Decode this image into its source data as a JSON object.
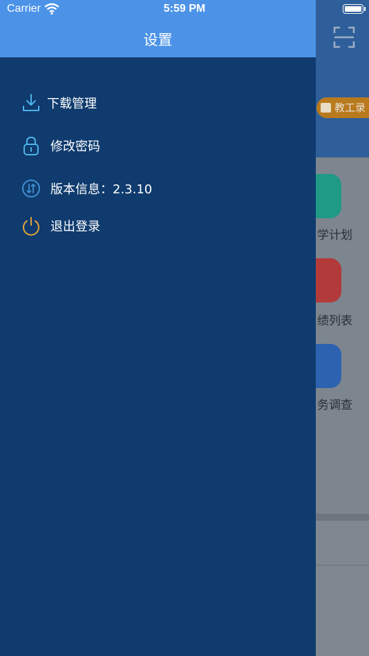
{
  "status_bar": {
    "carrier": "Carrier",
    "time": "5:59 PM"
  },
  "drawer": {
    "title": "设置",
    "items": [
      {
        "label": "下载管理",
        "icon": "download-icon",
        "color": "#4fb3ea"
      },
      {
        "label": "修改密码",
        "icon": "lock-icon",
        "color": "#4fb3ea"
      },
      {
        "label": "版本信息：2.3.10",
        "icon": "version-icon",
        "color": "#3f8ed0"
      },
      {
        "label": "退出登录",
        "icon": "power-icon",
        "color": "#e0a23b"
      }
    ]
  },
  "background": {
    "badge_label": "教工录",
    "tiles": [
      {
        "label": "学计划",
        "color": "#1f9a86"
      },
      {
        "label": "绩列表",
        "color": "#b23a3a"
      },
      {
        "label": "务调查",
        "color": "#2c62b0"
      }
    ]
  },
  "colors": {
    "drawer_bg": "#0f3b6e",
    "drawer_header": "#4c93e8"
  }
}
